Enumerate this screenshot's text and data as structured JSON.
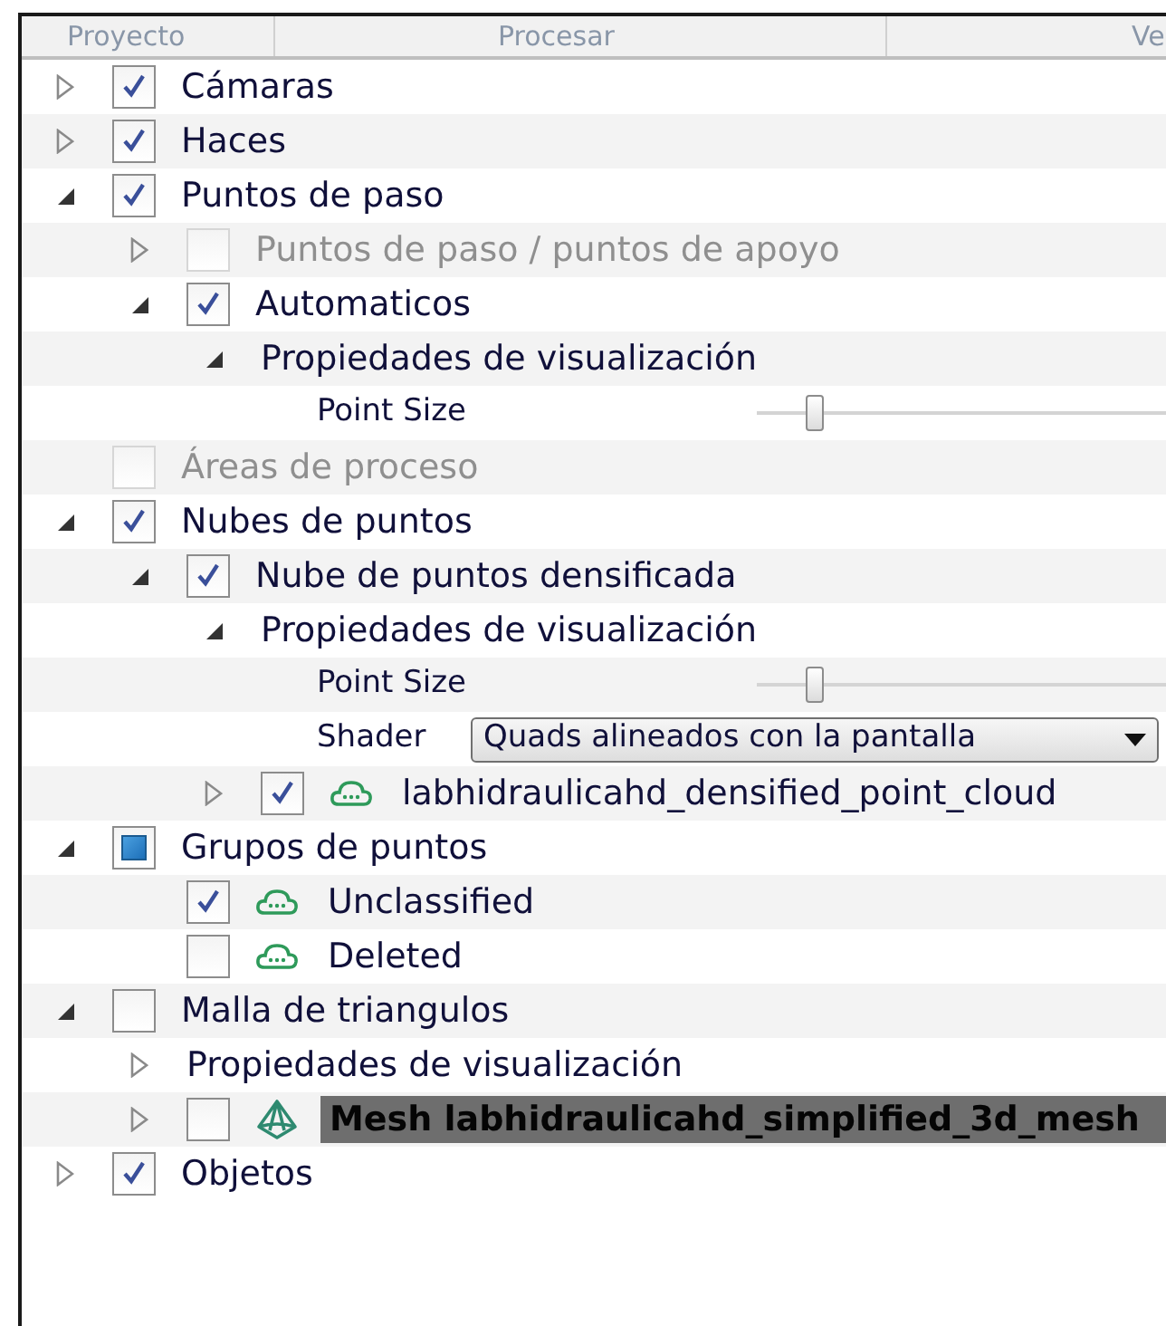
{
  "header": {
    "columns": [
      "Proyecto",
      "Procesar",
      "Ve"
    ]
  },
  "tree": [
    {
      "kind": "node",
      "label": "Cámaras",
      "expanded": false,
      "checked": true,
      "disabled": false,
      "selected": false
    },
    {
      "kind": "node",
      "label": "Haces",
      "expanded": false,
      "checked": true,
      "disabled": false,
      "selected": false
    },
    {
      "kind": "node",
      "label": "Puntos de paso",
      "expanded": true,
      "checked": true,
      "disabled": false,
      "selected": false,
      "children": [
        {
          "kind": "node",
          "label": "Puntos de paso /  puntos de apoyo",
          "expanded": false,
          "checked": false,
          "disabled": true,
          "selected": false
        },
        {
          "kind": "node",
          "label": "Automaticos",
          "expanded": true,
          "checked": true,
          "disabled": false,
          "selected": false,
          "children": [
            {
              "kind": "node",
              "label": "Propiedades de visualización",
              "expanded": true,
              "disabled": false,
              "selected": false,
              "children": [
                {
                  "kind": "slider",
                  "label": "Point Size",
                  "level": 0.14
                }
              ]
            }
          ]
        }
      ]
    },
    {
      "kind": "node",
      "label": "Áreas de proceso",
      "checked": false,
      "disabled": true,
      "selected": false
    },
    {
      "kind": "node",
      "label": "Nubes de puntos",
      "expanded": true,
      "checked": true,
      "disabled": false,
      "selected": false,
      "children": [
        {
          "kind": "node",
          "label": "Nube de puntos densificada",
          "expanded": true,
          "checked": true,
          "disabled": false,
          "selected": false,
          "children": [
            {
              "kind": "node",
              "label": "Propiedades de visualización",
              "expanded": true,
              "disabled": false,
              "selected": false,
              "children": [
                {
                  "kind": "slider",
                  "label": "Point Size",
                  "level": 0.14
                },
                {
                  "kind": "dropdown",
                  "label": "Shader",
                  "value": "Quads alineados con la pantalla"
                }
              ]
            },
            {
              "kind": "cloud",
              "label": "labhidraulicahd_densified_point_cloud",
              "expanded": false,
              "checked": true,
              "disabled": false,
              "selected": false
            }
          ]
        }
      ]
    },
    {
      "kind": "node",
      "label": "Grupos de puntos",
      "expanded": true,
      "checked": false,
      "indeterminate": true,
      "disabled": false,
      "selected": false,
      "children": [
        {
          "kind": "cloud",
          "label": "Unclassified",
          "checked": true,
          "disabled": false,
          "selected": false
        },
        {
          "kind": "cloud",
          "label": "Deleted",
          "checked": false,
          "disabled": false,
          "selected": false
        }
      ]
    },
    {
      "kind": "node",
      "label": "Malla de triangulos",
      "expanded": true,
      "checked": false,
      "disabled": false,
      "selected": false,
      "children": [
        {
          "kind": "node",
          "label": "Propiedades de visualización",
          "expanded": false,
          "disabled": false,
          "selected": false
        },
        {
          "kind": "mesh",
          "label": "Mesh labhidraulicahd_simplified_3d_mesh",
          "expanded": false,
          "checked": false,
          "disabled": false,
          "selected": true
        }
      ]
    },
    {
      "kind": "node",
      "label": "Objetos",
      "expanded": false,
      "checked": true,
      "disabled": false,
      "selected": false
    }
  ]
}
